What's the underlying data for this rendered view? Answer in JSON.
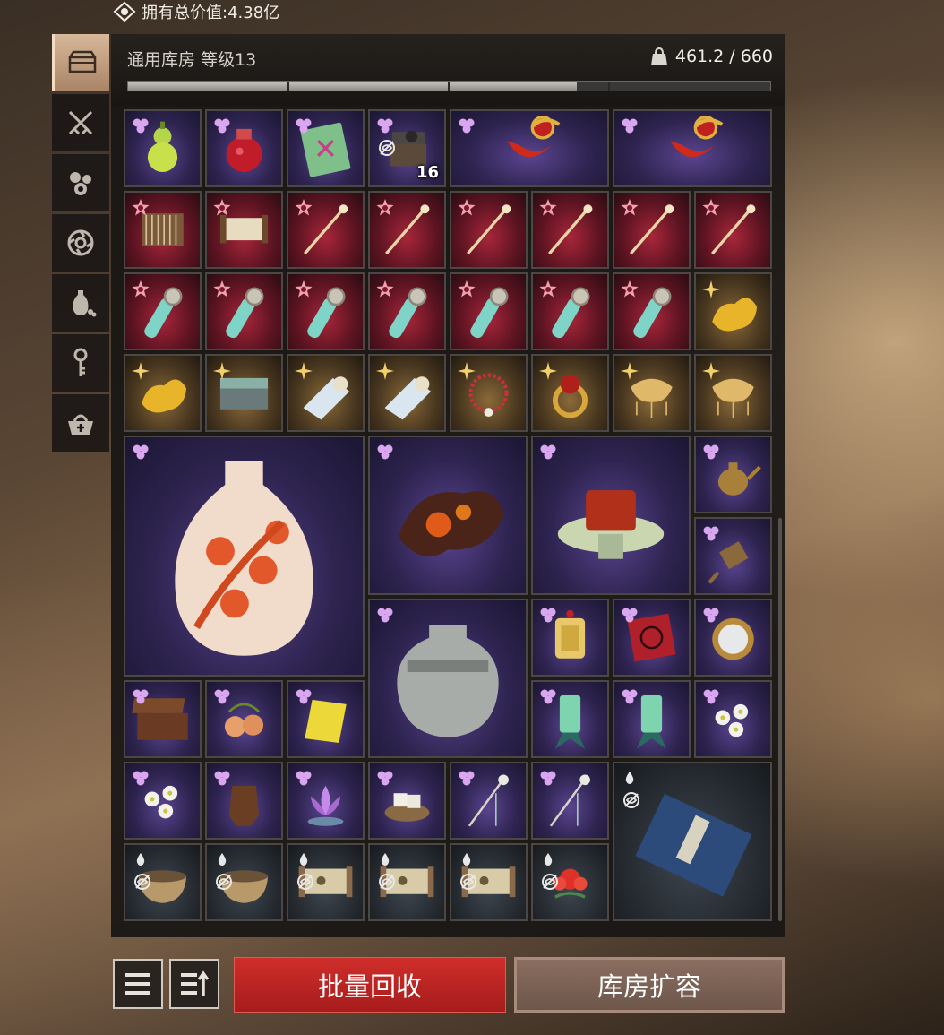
{
  "header": {
    "total_value_label": "拥有总价值:4.38亿",
    "warehouse_title": "通用库房 等级13",
    "capacity": "461.2 / 660",
    "capacity_fraction": 0.699
  },
  "sidebar": {
    "tabs": [
      {
        "icon": "chest-icon",
        "active": true
      },
      {
        "icon": "crossed-swords-icon",
        "active": false
      },
      {
        "icon": "flowers-icon",
        "active": false
      },
      {
        "icon": "jade-disc-icon",
        "active": false
      },
      {
        "icon": "vase-icon",
        "active": false
      },
      {
        "icon": "key-icon",
        "active": false
      },
      {
        "icon": "basket-icon",
        "active": false
      }
    ]
  },
  "items": [
    {
      "name": "green-gourd",
      "rarity": "purple",
      "icon": "gourd-icon"
    },
    {
      "name": "red-wine-jar",
      "rarity": "purple",
      "icon": "wine-jar-icon"
    },
    {
      "name": "green-card",
      "rarity": "purple",
      "icon": "card-icon"
    },
    {
      "name": "iron-box",
      "rarity": "purple",
      "icon": "iron-box-icon",
      "locked": true,
      "quantity": "16"
    },
    {
      "name": "red-blade-1",
      "rarity": "purple",
      "icon": "red-blade-icon"
    },
    {
      "name": "red-blade-2",
      "rarity": "purple",
      "icon": "red-blade-icon"
    },
    {
      "name": "harp",
      "rarity": "red",
      "icon": "harp-icon"
    },
    {
      "name": "scroll",
      "rarity": "red",
      "icon": "scroll-icon"
    },
    {
      "name": "hairpin-1",
      "rarity": "red",
      "icon": "hairpin-icon"
    },
    {
      "name": "hairpin-2",
      "rarity": "red",
      "icon": "hairpin-icon"
    },
    {
      "name": "hairpin-3",
      "rarity": "red",
      "icon": "hairpin-icon"
    },
    {
      "name": "hairpin-4",
      "rarity": "red",
      "icon": "hairpin-icon"
    },
    {
      "name": "hairpin-5",
      "rarity": "red",
      "icon": "hairpin-icon"
    },
    {
      "name": "hairpin-6",
      "rarity": "red",
      "icon": "hairpin-icon"
    },
    {
      "name": "jade-rod-1",
      "rarity": "red",
      "icon": "jade-rod-icon"
    },
    {
      "name": "jade-rod-2",
      "rarity": "red",
      "icon": "jade-rod-icon"
    },
    {
      "name": "jade-rod-3",
      "rarity": "red",
      "icon": "jade-rod-icon"
    },
    {
      "name": "jade-rod-4",
      "rarity": "red",
      "icon": "jade-rod-icon"
    },
    {
      "name": "jade-rod-5",
      "rarity": "red",
      "icon": "jade-rod-icon"
    },
    {
      "name": "jade-rod-6",
      "rarity": "red",
      "icon": "jade-rod-icon"
    },
    {
      "name": "jade-rod-7",
      "rarity": "red",
      "icon": "jade-rod-icon"
    },
    {
      "name": "gold-nugget-1",
      "rarity": "gold",
      "icon": "gold-nugget-icon"
    },
    {
      "name": "gold-nugget-2",
      "rarity": "gold",
      "icon": "gold-nugget-icon"
    },
    {
      "name": "jade-chest",
      "rarity": "gold",
      "icon": "jade-chest-icon"
    },
    {
      "name": "silk-roll-1",
      "rarity": "gold",
      "icon": "silk-roll-icon"
    },
    {
      "name": "silk-roll-2",
      "rarity": "gold",
      "icon": "silk-roll-icon"
    },
    {
      "name": "bead-necklace",
      "rarity": "gold",
      "icon": "necklace-icon"
    },
    {
      "name": "ruby-ring",
      "rarity": "gold",
      "icon": "ring-icon"
    },
    {
      "name": "gold-lock-pendant-1",
      "rarity": "gold",
      "icon": "lock-pendant-icon"
    },
    {
      "name": "gold-lock-pendant-2",
      "rarity": "gold",
      "icon": "lock-pendant-icon"
    },
    {
      "name": "plum-blossom-vase",
      "rarity": "purple",
      "icon": "vase-icon"
    },
    {
      "name": "amber-root",
      "rarity": "purple",
      "icon": "amber-icon"
    },
    {
      "name": "braised-pork",
      "rarity": "purple",
      "icon": "dish-icon"
    },
    {
      "name": "teapot",
      "rarity": "purple",
      "icon": "teapot-icon"
    },
    {
      "name": "bronze-tool",
      "rarity": "purple",
      "icon": "tool-icon"
    },
    {
      "name": "gray-jar",
      "rarity": "purple",
      "icon": "jar-icon"
    },
    {
      "name": "tassel-plaque",
      "rarity": "purple",
      "icon": "plaque-icon"
    },
    {
      "name": "paper-cut",
      "rarity": "purple",
      "icon": "paper-cut-icon"
    },
    {
      "name": "bronze-mirror",
      "rarity": "purple",
      "icon": "mirror-icon"
    },
    {
      "name": "wooden-case",
      "rarity": "purple",
      "icon": "case-icon"
    },
    {
      "name": "peaches",
      "rarity": "purple",
      "icon": "peach-icon"
    },
    {
      "name": "yellow-paper",
      "rarity": "purple",
      "icon": "paper-icon"
    },
    {
      "name": "jade-seal-1",
      "rarity": "purple",
      "icon": "jade-seal-icon"
    },
    {
      "name": "jade-seal-2",
      "rarity": "purple",
      "icon": "jade-seal-icon"
    },
    {
      "name": "white-flowers-1",
      "rarity": "purple",
      "icon": "white-flower-icon"
    },
    {
      "name": "white-flowers-2",
      "rarity": "purple",
      "icon": "white-flower-icon"
    },
    {
      "name": "leather-glove",
      "rarity": "purple",
      "icon": "glove-icon"
    },
    {
      "name": "lotus-lamp",
      "rarity": "purple",
      "icon": "lotus-icon"
    },
    {
      "name": "white-cakes",
      "rarity": "purple",
      "icon": "cake-icon"
    },
    {
      "name": "jade-hairpin-1",
      "rarity": "purple",
      "icon": "jade-hairpin-icon"
    },
    {
      "name": "jade-hairpin-2",
      "rarity": "purple",
      "icon": "jade-hairpin-icon"
    },
    {
      "name": "blue-book",
      "rarity": "dark",
      "icon": "book-icon",
      "locked": true
    },
    {
      "name": "bowl-1",
      "rarity": "dark",
      "icon": "bowl-icon",
      "locked": true
    },
    {
      "name": "bowl-2",
      "rarity": "dark",
      "icon": "bowl-icon",
      "locked": true
    },
    {
      "name": "map-scroll-1",
      "rarity": "dark",
      "icon": "map-scroll-icon",
      "locked": true
    },
    {
      "name": "map-scroll-2",
      "rarity": "dark",
      "icon": "map-scroll-icon",
      "locked": true
    },
    {
      "name": "map-scroll-3",
      "rarity": "dark",
      "icon": "map-scroll-icon",
      "locked": true
    },
    {
      "name": "red-flower",
      "rarity": "dark",
      "icon": "red-flower-icon",
      "locked": true
    }
  ],
  "buttons": {
    "list_view_icon": "list-icon",
    "sort_icon": "sort-icon",
    "recycle_label": "批量回收",
    "expand_label": "库房扩容"
  }
}
